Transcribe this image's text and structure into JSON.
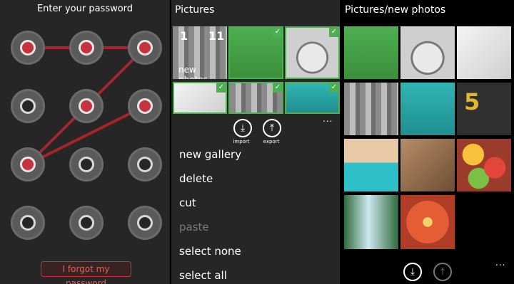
{
  "lock_screen": {
    "title": "Enter your password",
    "forgot_label": "I forgot my password",
    "grid": [
      [
        1,
        1,
        1
      ],
      [
        0,
        1,
        1
      ],
      [
        1,
        0,
        0
      ],
      [
        0,
        0,
        0
      ]
    ],
    "accent_color": "#c8323c"
  },
  "pictures_menu": {
    "header": "Pictures",
    "tile_label": "new photos",
    "tile_counts": [
      "1",
      "11"
    ],
    "actions": [
      {
        "label": "import",
        "icon": "import-icon"
      },
      {
        "label": "export",
        "icon": "export-icon"
      }
    ],
    "menu_items": [
      {
        "label": "new gallery",
        "enabled": true
      },
      {
        "label": "delete",
        "enabled": true
      },
      {
        "label": "cut",
        "enabled": true
      },
      {
        "label": "paste",
        "enabled": false
      },
      {
        "label": "select none",
        "enabled": true
      },
      {
        "label": "select all",
        "enabled": true
      }
    ],
    "more": "...",
    "selection_color": "#4caf50"
  },
  "new_photos": {
    "header": "Pictures/new photos",
    "photos": [
      "soccer-photo",
      "wheel-photo",
      "building-photo",
      "building-3-photo",
      "teal-wall-photo",
      "road-5-photo",
      "pool-photo",
      "shadow-photo",
      "fruit-photo",
      "waterfall-photo",
      "flower-photo"
    ],
    "road_number": "5",
    "more": "..."
  }
}
